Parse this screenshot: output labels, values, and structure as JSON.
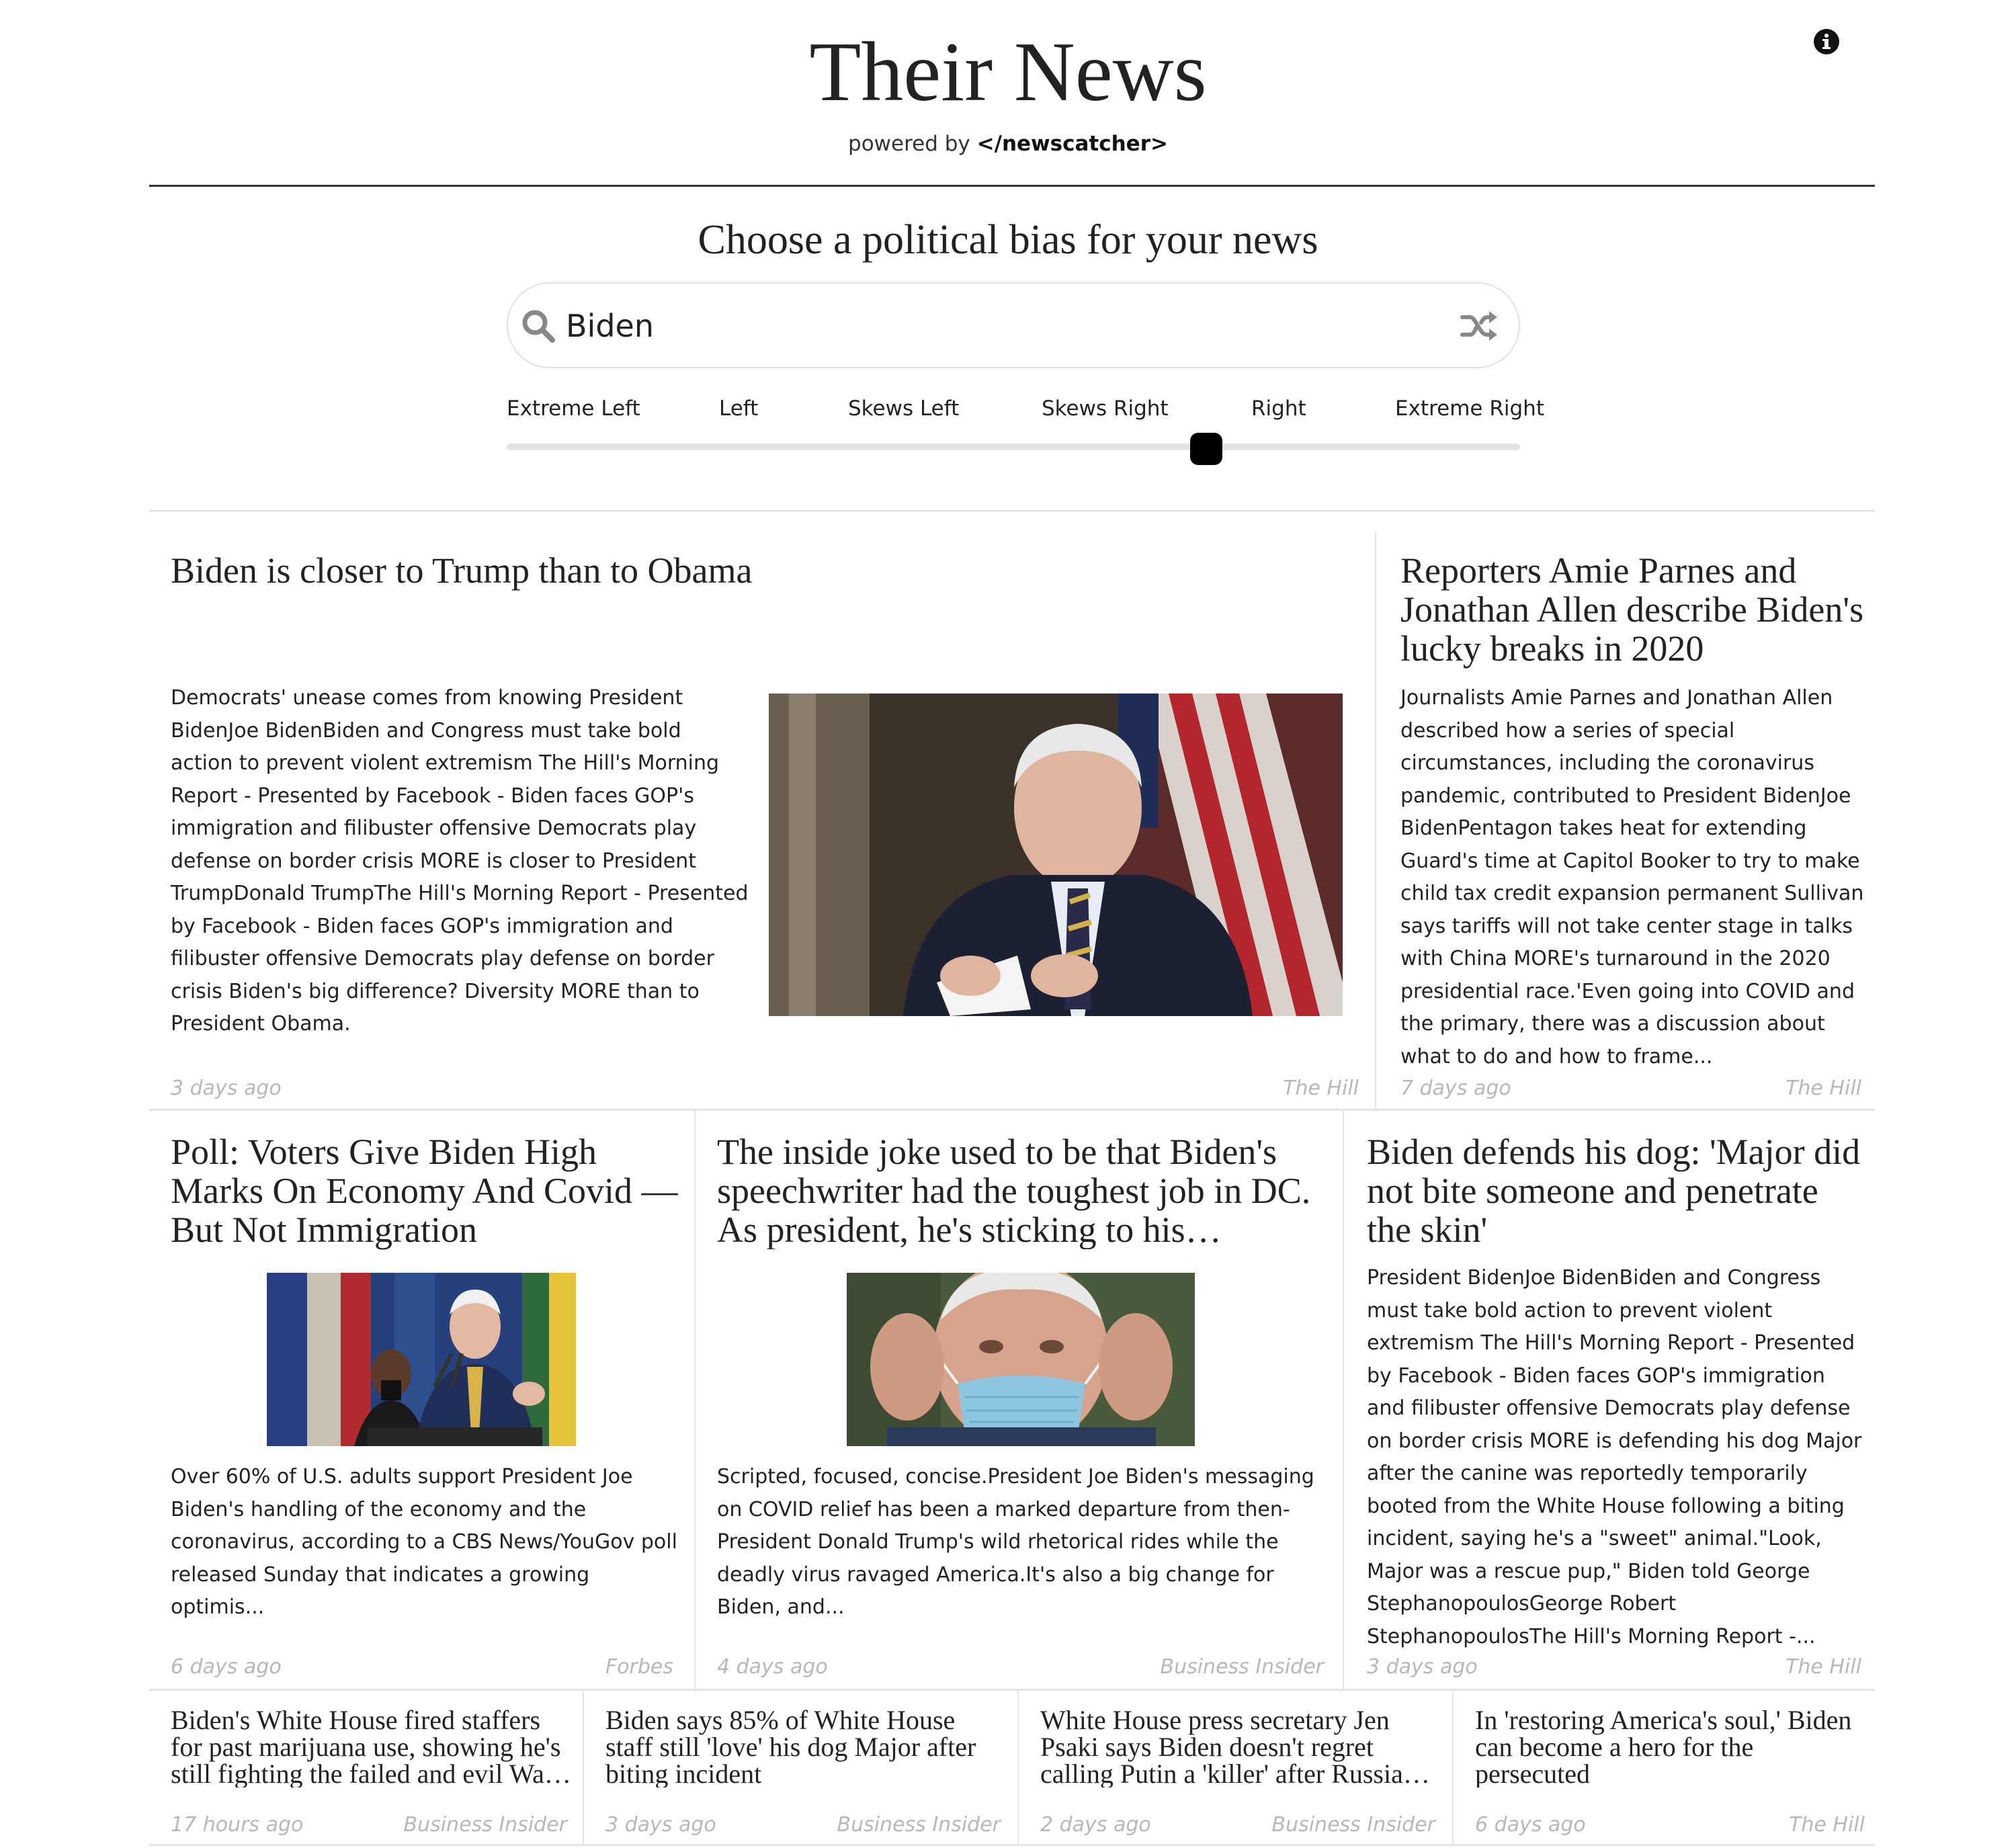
{
  "header": {
    "title": "Their News",
    "powered_prefix": "powered by",
    "powered_brand": "</newscatcher>",
    "info_icon": "info-circle-icon"
  },
  "bias": {
    "heading": "Choose a political bias for your news",
    "search_value": "Biden",
    "labels": [
      "Extreme Left",
      "Left",
      "Skews Left",
      "Skews Right",
      "Right",
      "Extreme Right"
    ],
    "selected": "Right",
    "slider_fraction": 0.69
  },
  "articles": [
    {
      "title": "Biden is closer to Trump than to Obama",
      "description": "Democrats' unease comes from knowing President BidenJoe BidenBiden and Congress must take bold action to prevent violent extremism The Hill's Morning Report - Presented by Facebook - Biden faces GOP's immigration and filibuster offensive Democrats play defense on border crisis MORE is closer to President TrumpDonald TrumpThe Hill's Morning Report - Presented by Facebook - Biden faces GOP's immigration and filibuster offensive Democrats play defense on border crisis Biden's big difference? Diversity MORE than to President Obama.",
      "time": "3 days ago",
      "source": "The Hill"
    },
    {
      "title": "Reporters Amie Parnes and Jonathan Allen describe Biden's lucky breaks in 2020",
      "description": "Journalists Amie Parnes and Jonathan Allen described how a series of special circumstances, including the coronavirus pandemic, contributed to President BidenJoe BidenPentagon takes heat for extending Guard's time at Capitol Booker to try to make child tax credit expansion permanent Sullivan says tariffs will not take center stage in talks with China MORE's turnaround in the 2020 presidential race.'Even going into COVID and the primary, there was a discussion about what to do and how to frame...",
      "time": "7 days ago",
      "source": "The Hill"
    },
    {
      "title": "Poll: Voters Give Biden High Marks On Economy And Covid — But Not Immigration",
      "description": "Over 60% of U.S. adults support President Joe Biden's handling of the economy and the coronavirus, according to a CBS News/YouGov poll released Sunday that indicates a growing optimis...",
      "time": "6 days ago",
      "source": "Forbes"
    },
    {
      "title": "The inside joke used to be that Biden's speechwriter had the toughest job in DC. As president, he's sticking to his…",
      "description": "Scripted, focused, concise.President Joe Biden's messaging on COVID relief has been a marked departure from then-President Donald Trump's wild rhetorical rides while the deadly virus ravaged America.It's also a big change for Biden, and...",
      "time": "4 days ago",
      "source": "Business Insider"
    },
    {
      "title": "Biden defends his dog: 'Major did not bite someone and penetrate the skin'",
      "description": "President BidenJoe BidenBiden and Congress must take bold action to prevent violent extremism The Hill's Morning Report - Presented by Facebook - Biden faces GOP's immigration and filibuster offensive Democrats play defense on border crisis MORE is defending his dog Major after the canine was reportedly temporarily booted from the White House following a biting incident, saying he's a \"sweet\" animal.\"Look, Major was a rescue pup,\" Biden told George StephanopoulosGeorge Robert StephanopoulosThe Hill's Morning Report -...",
      "time": "3 days ago",
      "source": "The Hill"
    },
    {
      "title": "Biden's White House fired staffers for past marijuana use, showing he's still fighting the failed and evil Wa…",
      "time": "17 hours ago",
      "source": "Business Insider"
    },
    {
      "title": "Biden says 85% of White House staff still 'love' his dog Major after biting incident",
      "time": "3 days ago",
      "source": "Business Insider"
    },
    {
      "title": "White House press secretary Jen Psaki says Biden doesn't regret calling Putin a 'killer' after Russia…",
      "time": "2 days ago",
      "source": "Business Insider"
    },
    {
      "title": "In 'restoring America's soul,' Biden can become a hero for the persecuted",
      "time": "6 days ago",
      "source": "The Hill"
    }
  ]
}
